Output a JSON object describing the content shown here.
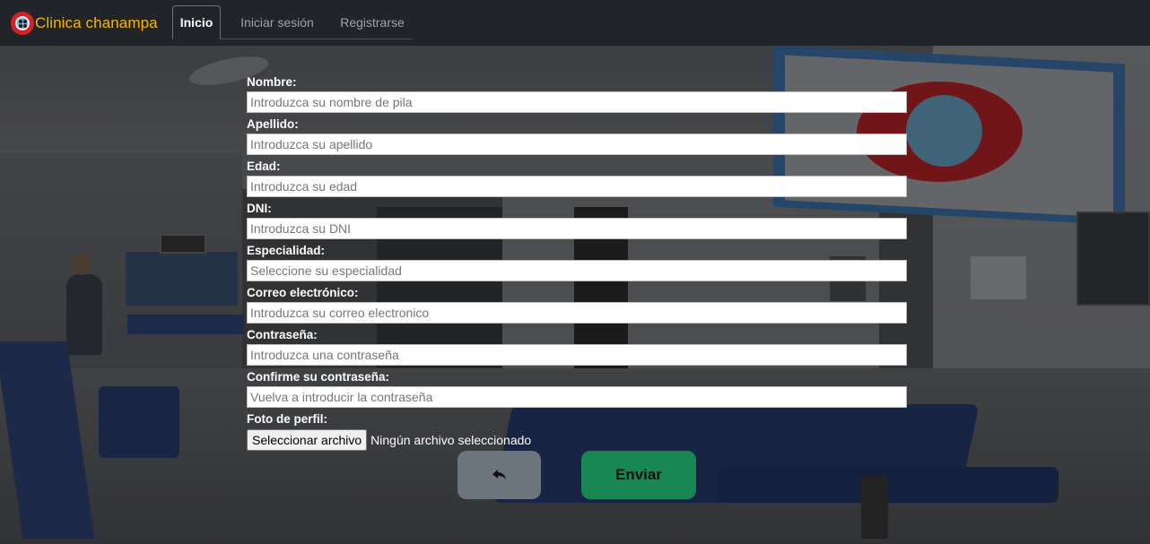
{
  "navbar": {
    "brand": "Clinica chanampa",
    "tabs": [
      {
        "label": "Inicio",
        "active": true
      },
      {
        "label": "Iniciar sesión",
        "active": false
      },
      {
        "label": "Registrarse",
        "active": false
      }
    ]
  },
  "form": {
    "fields": [
      {
        "label": "Nombre:",
        "placeholder": "Introduzca su nombre de pila"
      },
      {
        "label": "Apellido:",
        "placeholder": "Introduzca su apellido"
      },
      {
        "label": "Edad:",
        "placeholder": "Introduzca su edad"
      },
      {
        "label": "DNI:",
        "placeholder": "Introduzca su DNI"
      },
      {
        "label": "Especialidad:",
        "placeholder": "Seleccione su especialidad"
      },
      {
        "label": "Correo electrónico:",
        "placeholder": "Introduzca su correo electronico"
      },
      {
        "label": "Contraseña:",
        "placeholder": "Introduzca una contraseña"
      },
      {
        "label": "Confirme su contraseña:",
        "placeholder": "Vuelva a introducir la contraseña"
      }
    ],
    "photo": {
      "label": "Foto de perfil:",
      "button": "Seleccionar archivo",
      "status": "Ningún archivo seleccionado"
    },
    "back_icon": "reply-arrow-icon",
    "submit_label": "Enviar"
  },
  "colors": {
    "navbar_bg": "#212529",
    "brand": "#f7b500",
    "back_button": "#6c757d",
    "submit_button": "#198754"
  }
}
